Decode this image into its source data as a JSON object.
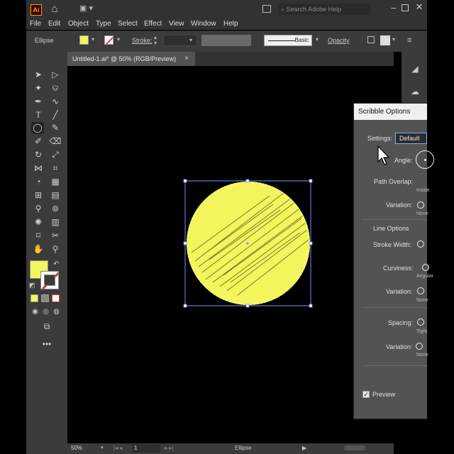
{
  "app": {
    "logo": "Ai",
    "search_placeholder": "Search Adobe Help"
  },
  "menu": [
    "File",
    "Edit",
    "Object",
    "Type",
    "Select",
    "Effect",
    "View",
    "Window",
    "Help"
  ],
  "control_bar": {
    "selection_type": "Ellipse",
    "stroke_label": "Stroke:",
    "brush_label": "Basic",
    "opacity_label": "Opacity",
    "fill_color": "#f2f55c"
  },
  "document": {
    "tab_title": "Untitled-1.ai* @ 50% (RGB/Preview)",
    "close_glyph": "×"
  },
  "status_bar": {
    "zoom": "50%",
    "artboard": "1",
    "current_tool": "Ellipse"
  },
  "dialog": {
    "title": "Scribble Options",
    "settings_label": "Settings:",
    "settings_value": "Default",
    "angle_label": "Angle:",
    "path_overlap_label": "Path Overlap:",
    "path_overlap_hint": "Inside",
    "variation_label": "Variation:",
    "none_hint": "None",
    "line_options_label": "Line Options",
    "stroke_width_label": "Stroke Width:",
    "curviness_label": "Curviness:",
    "curviness_hint": "Angular",
    "spacing_label": "Spacing:",
    "spacing_hint": "Tight",
    "preview_label": "Preview",
    "preview_checked": true
  },
  "colors": {
    "scribble_fill": "#f2f55c",
    "canvas_bg": "#000000",
    "selection": "#7b8cff"
  }
}
